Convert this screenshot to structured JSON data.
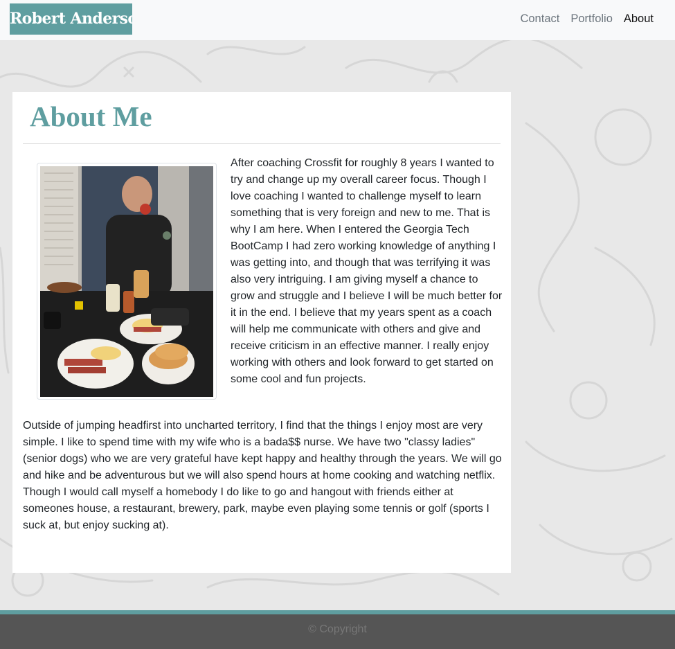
{
  "navbar": {
    "brand": "Robert Anderson",
    "links": [
      {
        "label": "Contact",
        "active": false
      },
      {
        "label": "Portfolio",
        "active": false
      },
      {
        "label": "About",
        "active": true
      }
    ]
  },
  "about": {
    "title": "About Me",
    "paragraph_1": "After coaching Crossfit for roughly 8 years I wanted to try and change up my overall career focus. Though I love coaching I wanted to challenge myself to learn something that is very foreign and new to me. That is why I am here. When I entered the Georgia Tech BootCamp I had zero working knowledge of anything I was getting into, and though that was terrifying it was also very intriguing. I am giving myself a chance to grow and struggle and I believe I will be much better for it in the end. I believe that my years spent as a coach will help me communicate with others and give and receive criticism in an effective manner. I really enjoy working with others and look forward to get started on some cool and fun projects.",
    "paragraph_2": "Outside of jumping headfirst into uncharted territory, I find that the things I enjoy most are very simple. I like to spend time with my wife who is a bada$$ nurse. We have two \"classy ladies\" (senior dogs) who we are very grateful have kept happy and healthy through the years. We will go and hike and be adventurous but we will also spend hours at home cooking and watching netflix. Though I would call myself a homebody I do like to go and hangout with friends either at someones house, a restaurant, brewery, park, maybe even playing some tennis or golf (sports I suck at, but enjoy sucking at)."
  },
  "footer": {
    "text": "© Copyright"
  },
  "colors": {
    "accent": "#5f9ea0",
    "navbar_bg": "#f8f9fa",
    "footer_bg": "#555555"
  }
}
